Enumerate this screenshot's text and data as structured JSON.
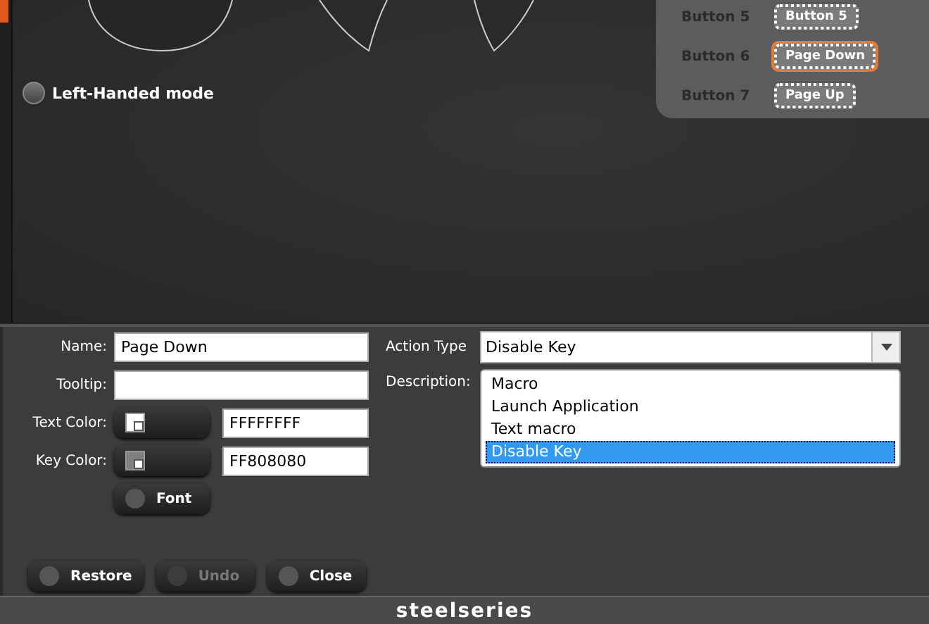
{
  "canvas": {
    "left_handed_mode": {
      "label": "Left-Handed mode",
      "checked": false
    },
    "key_buttons": [
      {
        "label": "Button 5",
        "key": "Button 5",
        "selected": false
      },
      {
        "label": "Button 6",
        "key": "Page Down",
        "selected": true
      },
      {
        "label": "Button 7",
        "key": "Page Up",
        "selected": false
      }
    ]
  },
  "properties": {
    "name": {
      "label": "Name:",
      "value": "Page Down"
    },
    "tooltip": {
      "label": "Tooltip:"
    },
    "text_color": {
      "label": "Text Color:",
      "value": "FFFFFFFF"
    },
    "key_color": {
      "label": "Key Color:",
      "value": "FF808080"
    },
    "font_button": "Font",
    "action_type": {
      "label": "Action Type",
      "value": "Disable Key",
      "expanded": true,
      "options": [
        {
          "label": "Macro",
          "selected": false
        },
        {
          "label": "Launch Application",
          "selected": false
        },
        {
          "label": "Text macro",
          "selected": false
        },
        {
          "label": "Disable Key",
          "selected": true
        }
      ]
    },
    "description": {
      "label": "Description:"
    }
  },
  "buttons": [
    {
      "label": "Restore",
      "disabled": false
    },
    {
      "label": "Undo",
      "disabled": true
    },
    {
      "label": "Close",
      "disabled": false
    }
  ],
  "footer": {
    "logo": "steelseries"
  }
}
